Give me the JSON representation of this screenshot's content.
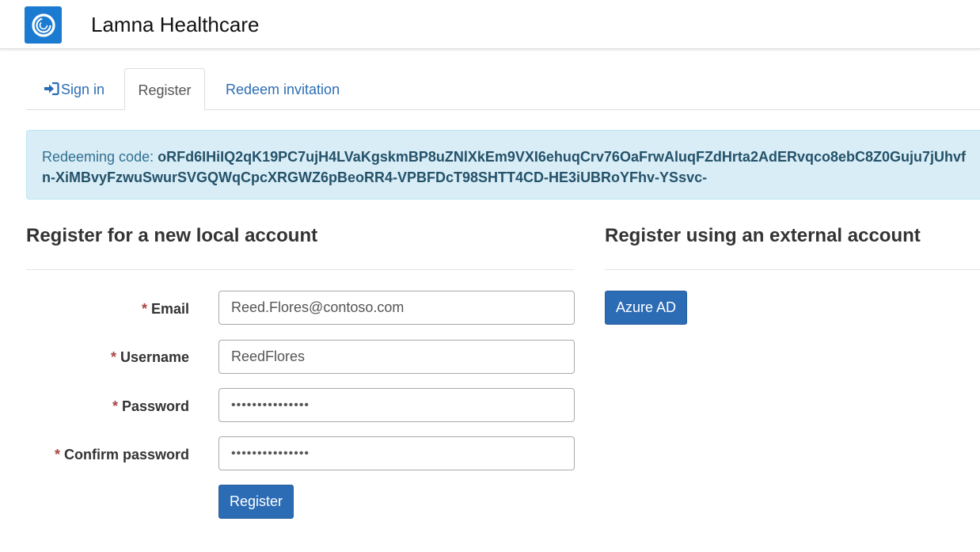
{
  "header": {
    "brand": "Lamna Healthcare",
    "logo_icon": "ring-logo"
  },
  "tabs": [
    {
      "label": "Sign in",
      "icon": "sign-in-icon",
      "active": false
    },
    {
      "label": "Register",
      "active": true
    },
    {
      "label": "Redeem invitation",
      "active": false
    }
  ],
  "alert": {
    "prefix": "Redeeming code: ",
    "code": "oRFd6IHiIQ2qK19PC7ujH4LVaKgskmBP8uZNlXkEm9VXI6ehuqCrv76OaFrwAluqFZdHrta2AdERvqco8ebC8Z0Guju7jUhvfn-XiMBvyFzwuSwurSVGQWqCpcXRGWZ6pBeoRR4-VPBFDcT98SHTT4CD-HE3iUBRoYFhv-YSsvc-"
  },
  "local": {
    "heading": "Register for a new local account",
    "required_mark": "*",
    "fields": {
      "email": {
        "label": "Email",
        "value": "Reed.Flores@contoso.com"
      },
      "username": {
        "label": "Username",
        "value": "ReedFlores"
      },
      "password": {
        "label": "Password",
        "value": "•••••••••••••••"
      },
      "confirm": {
        "label": "Confirm password",
        "value": "•••••••••••••••"
      }
    },
    "submit_label": "Register"
  },
  "external": {
    "heading": "Register using an external account",
    "providers": [
      {
        "label": "Azure AD"
      }
    ]
  },
  "colors": {
    "brand_blue": "#1b7bd1",
    "link": "#2c6cb5",
    "alert_bg": "#d9edf7",
    "alert_text": "#31708f",
    "required": "#a94442"
  }
}
